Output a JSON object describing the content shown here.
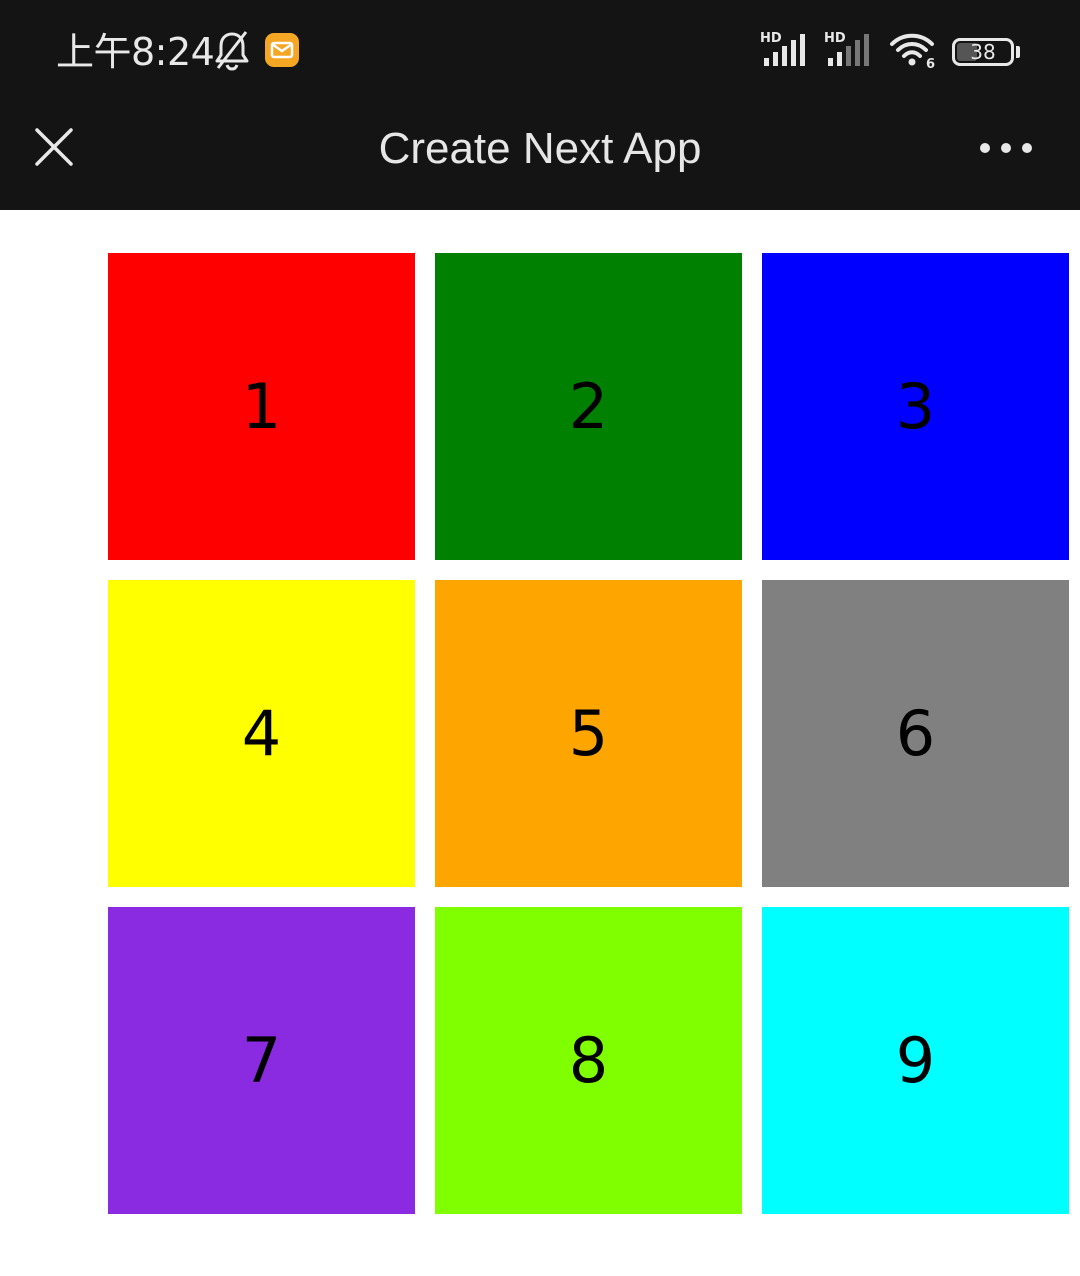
{
  "status_bar": {
    "time": "上午8:24",
    "icons": [
      "bell-muted-icon",
      "mail-notification-icon",
      "hd-signal-icon",
      "hd-signal-icon",
      "wifi-6-icon",
      "battery-icon"
    ],
    "signal_1_label": "HD",
    "signal_2_label": "HD",
    "wifi_label": "6",
    "battery_percent": "38",
    "battery_level": 0.38,
    "mail_icon_color": "#f5a623"
  },
  "title_bar": {
    "title": "Create Next App",
    "close_icon": "close-icon",
    "more_icon": "more-horizontal-icon"
  },
  "grid": {
    "items": [
      {
        "label": "1",
        "color": "#ff0000"
      },
      {
        "label": "2",
        "color": "#008000"
      },
      {
        "label": "3",
        "color": "#0000ff"
      },
      {
        "label": "4",
        "color": "#ffff00"
      },
      {
        "label": "5",
        "color": "#ffa500"
      },
      {
        "label": "6",
        "color": "#808080"
      },
      {
        "label": "7",
        "color": "#8a2be2"
      },
      {
        "label": "8",
        "color": "#7fff00"
      },
      {
        "label": "9",
        "color": "#00ffff"
      }
    ]
  }
}
